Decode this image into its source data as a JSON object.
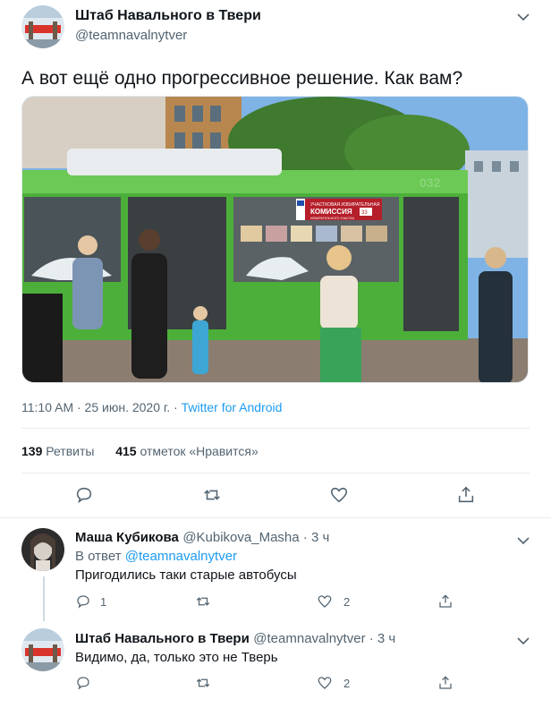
{
  "tweet": {
    "author_name": "Штаб Навального в Твери",
    "author_handle": "@teamnavalnytver",
    "text": "А вот ещё одно прогрессивное решение. Как вам?",
    "time": "11:10 AM · 25 июн. 2020 г. · ",
    "client": "Twitter for Android",
    "retweets_count": "139",
    "retweets_label": "Ретвиты",
    "likes_count": "415",
    "likes_label": "отметок «Нравится»",
    "photo_route_number": "032",
    "photo_banner_line1": "УЧАСТКОВАЯ ИЗБИРАТЕЛЬНАЯ",
    "photo_banner_line2": "КОМИССИЯ",
    "photo_banner_number": "33",
    "photo_banner_line3": "ИЗБИРАТЕЛЬНОГО УЧАСТКА"
  },
  "replies": [
    {
      "name": "Маша Кубикова",
      "handle": "@Kubikova_Masha · 3 ч",
      "reply_to_prefix": "В ответ ",
      "reply_to_handle": "@teamnavalnytver",
      "text": "Пригодились таки старые автобусы",
      "reply_count": "1",
      "like_count": "2"
    },
    {
      "name": "Штаб Навального в Твери",
      "handle": "@teamnavalnytver · 3 ч",
      "text": "Видимо, да, только это не Тверь",
      "like_count": "2"
    }
  ],
  "colors": {
    "accent": "#1d9bf0",
    "bus_green": "#4caf3a",
    "avatar_red": "#d9342b"
  },
  "icons": [
    "chevron-down-icon",
    "reply-icon",
    "retweet-icon",
    "like-icon",
    "share-icon"
  ]
}
